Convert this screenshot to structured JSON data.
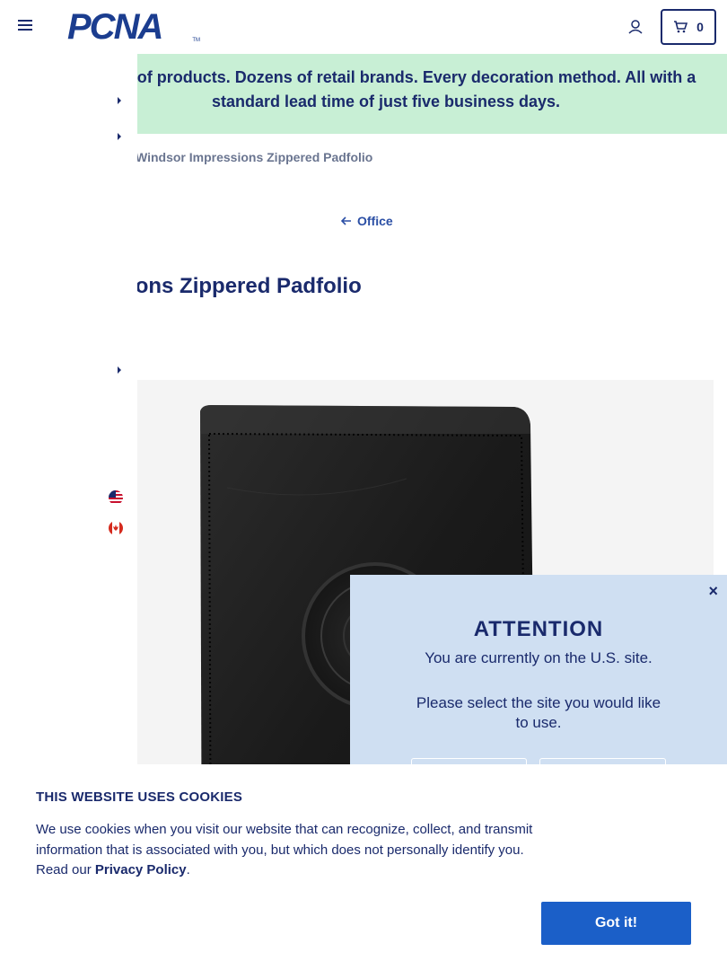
{
  "header": {
    "logo_text": "PCNA",
    "logo_tm": "TM",
    "cart_count": "0"
  },
  "banner": {
    "text": "usands of products. Dozens of retail brands. Every decoration method. All with a standard lead time of just five business days."
  },
  "breadcrumb": "Windsor Impressions Zippered Padfolio",
  "back_link": "Office",
  "product": {
    "title": "pressions Zippered Padfolio"
  },
  "attention": {
    "close": "×",
    "title": "ATTENTION",
    "message": "You are currently on the U.S. site.",
    "question": "Please select the site you would like to use."
  },
  "cookie": {
    "title": "THIS WEBSITE USES COOKIES",
    "text_before": "We use cookies when you visit our website that can recognize, collect, and transmit information that is associated with you, but which does not personally identify you. Read our ",
    "privacy_link": "Privacy Policy",
    "text_after": ".",
    "button": "Got it!"
  },
  "colors": {
    "navy": "#1a2a6c",
    "banner_bg": "#c8efd5",
    "popup_bg": "#cfdff2",
    "accent_blue": "#1b5fc8"
  },
  "icons": [
    "hamburger-icon",
    "account-icon",
    "cart-icon",
    "chevron-right-icon",
    "us-flag-icon",
    "canada-flag-icon",
    "arrow-left-icon",
    "close-icon"
  ]
}
